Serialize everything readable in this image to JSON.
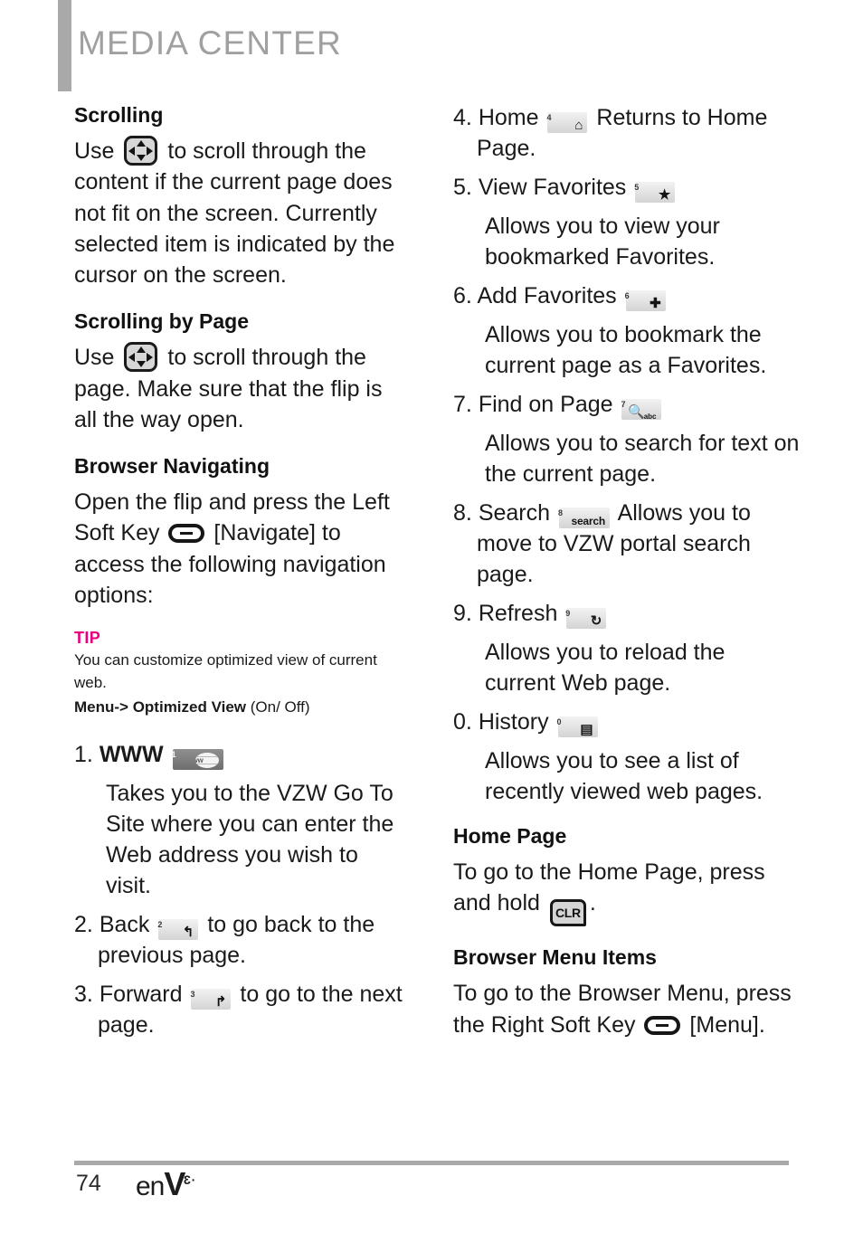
{
  "header": {
    "title": "MEDIA CENTER",
    "accent_color": "#a9a9a9"
  },
  "left_column": {
    "sections": [
      {
        "heading": "Scrolling",
        "body_before": "Use",
        "icon": "dpad-icon",
        "body_after": "to scroll through the content if the current page does not fit on the screen. Currently selected item is indicated by the cursor on the screen."
      },
      {
        "heading": "Scrolling by Page",
        "body_before": "Use",
        "icon": "dpad-icon",
        "body_after": "to scroll through the page. Make sure that the flip is all the way open."
      },
      {
        "heading": "Browser Navigating",
        "body_before": "Open the flip and press the Left Soft Key",
        "icon": "soft-key-icon",
        "bracket_label": "[Navigate]",
        "body_after": "to access the following navigation options:"
      }
    ],
    "tip": {
      "label": "TIP",
      "label_color": "#e6007e",
      "text": "You can customize optimized view of current web.",
      "menu_bold": "Menu-> Optimized View",
      "menu_rest": " (On/ Off)"
    },
    "items": [
      {
        "number": "1.",
        "name": "WWW",
        "key": {
          "digit": "1",
          "glyph": "www",
          "style": "dark-globe"
        },
        "description": "Takes you to the VZW Go To Site where you can enter the Web address you wish to visit."
      },
      {
        "number": "2.",
        "name": "Back",
        "key": {
          "digit": "2",
          "glyph": "↰",
          "style": "light"
        },
        "trailing": "to go back to the previous page."
      },
      {
        "number": "3.",
        "name": "Forward",
        "key": {
          "digit": "3",
          "glyph": "↱",
          "style": "light"
        },
        "trailing": "to go to the next page."
      }
    ]
  },
  "right_column": {
    "items": [
      {
        "number": "4.",
        "name": "Home",
        "key": {
          "digit": "4",
          "glyph": "⌂",
          "style": "light"
        },
        "trailing": "Returns to Home Page."
      },
      {
        "number": "5.",
        "name": "View Favorites",
        "key": {
          "digit": "5",
          "glyph": "★",
          "style": "light"
        },
        "description": "Allows you to view your bookmarked Favorites."
      },
      {
        "number": "6.",
        "name": "Add Favorites",
        "key": {
          "digit": "6",
          "glyph": "✚",
          "style": "light"
        },
        "description": "Allows you to bookmark the current page as a Favorites."
      },
      {
        "number": "7.",
        "name": "Find on Page",
        "key": {
          "digit": "7",
          "glyph": "🔍",
          "sub": "abc",
          "style": "light"
        },
        "description": "Allows you to search for text on the current page."
      },
      {
        "number": "8.",
        "name": "Search",
        "key": {
          "digit": "8",
          "glyph": "search",
          "style": "light-word"
        },
        "trailing": "Allows you to move to VZW portal search page."
      },
      {
        "number": "9.",
        "name": "Refresh",
        "key": {
          "digit": "9",
          "glyph": "↻",
          "style": "light"
        },
        "description": "Allows you to reload the current Web page."
      },
      {
        "number": "0.",
        "name": "History",
        "key": {
          "digit": "0",
          "glyph": "▤",
          "style": "light"
        },
        "description": "Allows you to see a list of recently viewed web pages."
      }
    ],
    "sections": [
      {
        "heading": "Home Page",
        "body_before": "To go to the Home Page, press and hold",
        "icon": "clr-key-icon",
        "icon_label": "CLR",
        "body_after": "."
      },
      {
        "heading": "Browser Menu Items",
        "body_before": "To go to the Browser Menu, press the Right Soft Key",
        "icon": "soft-key-icon",
        "bracket_label": "[Menu]",
        "body_after": "."
      }
    ]
  },
  "footer": {
    "page_number": "74",
    "brand_en": "en",
    "brand_v": "V",
    "brand_sup": "·3",
    "rule_color": "#a9a9a9"
  }
}
